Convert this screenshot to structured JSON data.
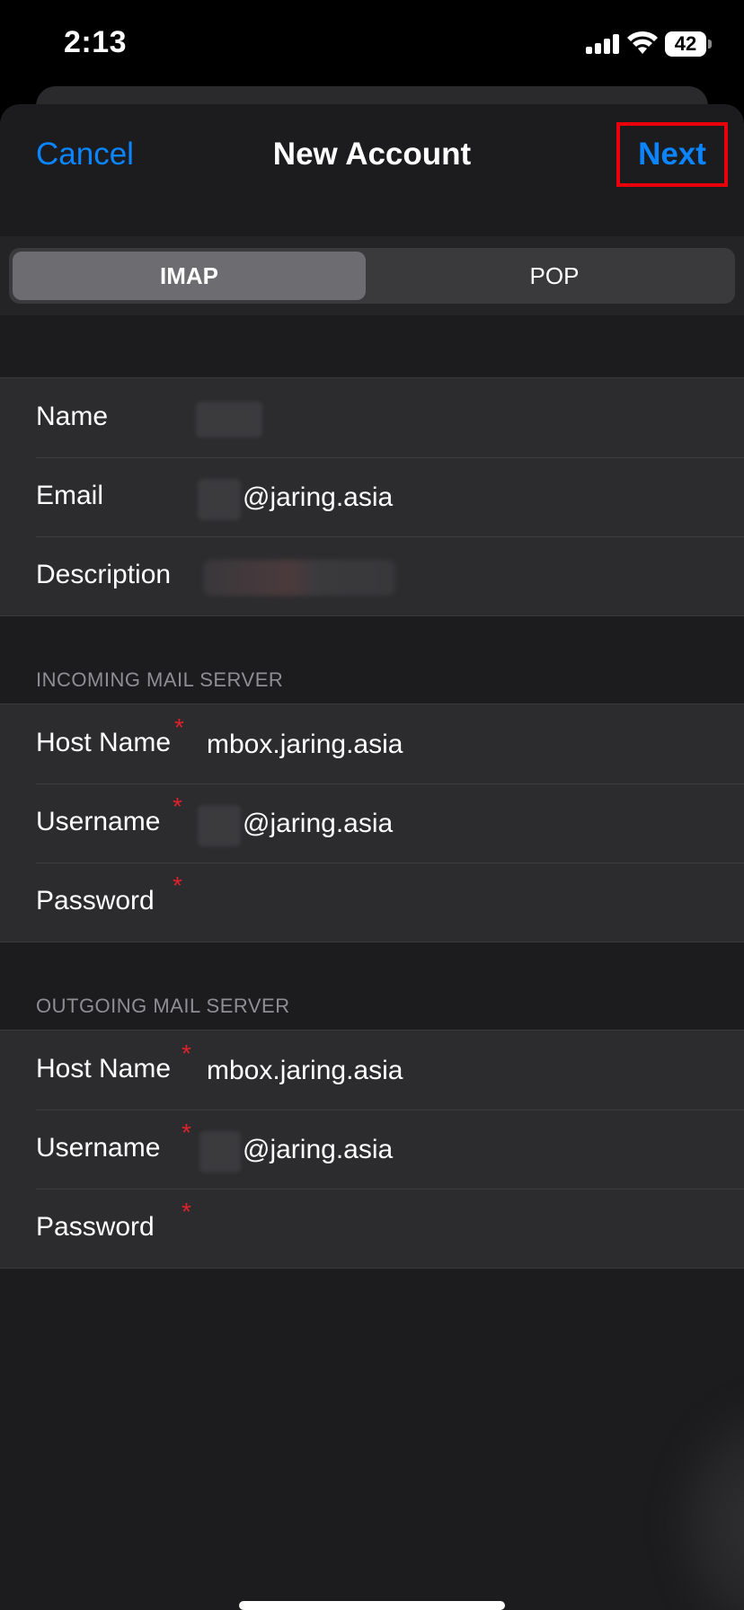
{
  "status_bar": {
    "time": "2:13",
    "battery_level": "42",
    "icons": [
      "cellular-signal-icon",
      "wifi-icon",
      "battery-icon"
    ]
  },
  "nav": {
    "cancel_label": "Cancel",
    "title": "New Account",
    "next_label": "Next"
  },
  "segmented_control": {
    "options": [
      "IMAP",
      "POP"
    ],
    "selected": "IMAP"
  },
  "account_fields": [
    {
      "label": "Name",
      "value": ""
    },
    {
      "label": "Email",
      "value": "@jaring.asia"
    },
    {
      "label": "Description",
      "value": ""
    }
  ],
  "incoming_server": {
    "header": "INCOMING MAIL SERVER",
    "fields": [
      {
        "label": "Host Name",
        "value": "mbox.jaring.asia",
        "required_mark": "*"
      },
      {
        "label": "Username",
        "value": "@jaring.asia",
        "required_mark": "*"
      },
      {
        "label": "Password",
        "value": "",
        "required_mark": "*"
      }
    ]
  },
  "outgoing_server": {
    "header": "OUTGOING MAIL SERVER",
    "fields": [
      {
        "label": "Host Name",
        "value": "mbox.jaring.asia",
        "required_mark": "*"
      },
      {
        "label": "Username",
        "value": "@jaring.asia",
        "required_mark": "*"
      },
      {
        "label": "Password",
        "value": "",
        "required_mark": "*"
      }
    ]
  },
  "colors": {
    "accent": "#0a84ff",
    "required": "#e0202a",
    "highlight_box": "#e8000b",
    "background": "#1c1c1e",
    "cell": "#2c2c2e"
  }
}
